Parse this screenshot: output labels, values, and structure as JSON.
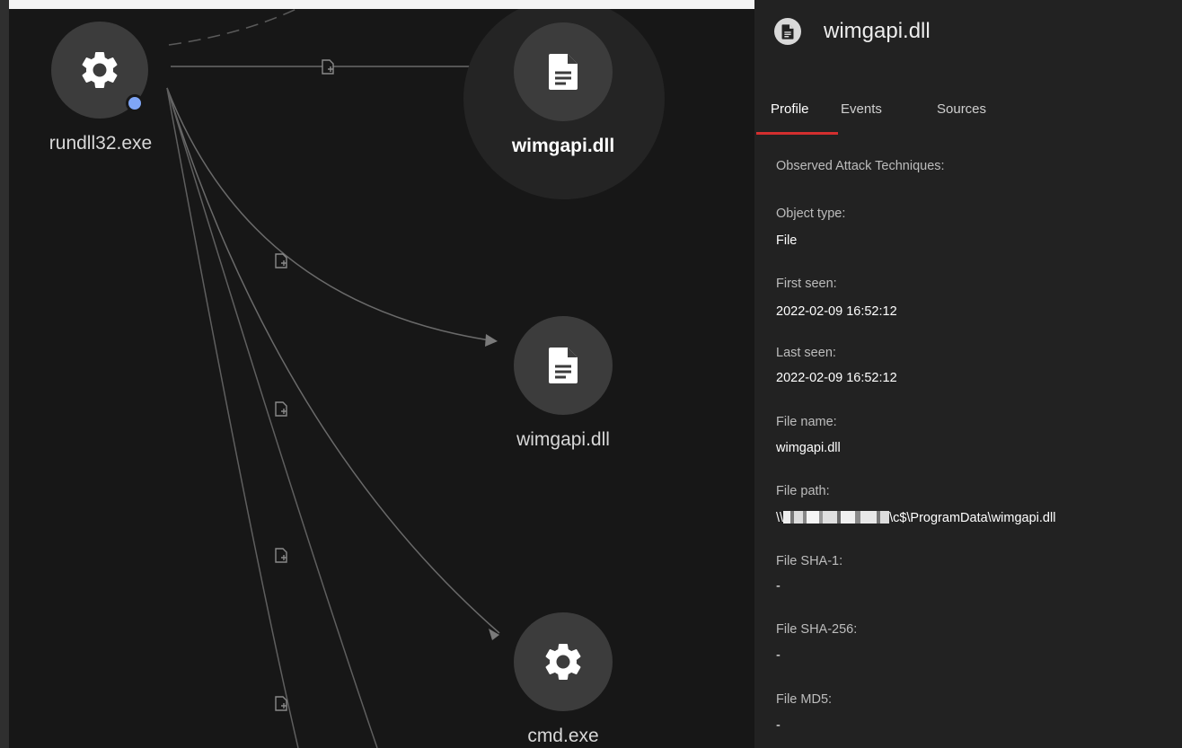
{
  "graph": {
    "nodes": {
      "rundll32": {
        "label": "rundll32.exe",
        "icon": "gear-icon"
      },
      "wimgapi_selected": {
        "label": "wimgapi.dll",
        "icon": "file-icon"
      },
      "wimgapi_second": {
        "label": "wimgapi.dll",
        "icon": "file-icon"
      },
      "cmd": {
        "label": "cmd.exe",
        "icon": "gear-icon"
      }
    },
    "edge_icon": "file-create-icon"
  },
  "panel": {
    "title": "wimgapi.dll",
    "header_icon": "file-icon",
    "tabs": [
      {
        "label": "Profile",
        "active": true
      },
      {
        "label": "Events",
        "active": false
      },
      {
        "label": "Sources",
        "active": false
      }
    ],
    "fields": {
      "attack_techniques": {
        "label": "Observed Attack Techniques:"
      },
      "object_type": {
        "label": "Object type:",
        "value": "File"
      },
      "first_seen": {
        "label": "First seen:",
        "value": "2022-02-09 16:52:12"
      },
      "last_seen": {
        "label": "Last seen:",
        "value": "2022-02-09 16:52:12"
      },
      "file_name": {
        "label": "File name:",
        "value": "wimgapi.dll"
      },
      "file_path": {
        "label": "File path:",
        "value_prefix": "\\\\",
        "value_suffix": "\\c$\\ProgramData\\wimgapi.dll"
      },
      "sha1": {
        "label": "File SHA-1:",
        "value": "-"
      },
      "sha256": {
        "label": "File SHA-256:",
        "value": "-"
      },
      "md5": {
        "label": "File MD5:",
        "value": "-"
      }
    }
  },
  "colors": {
    "background": "#161616",
    "panel": "#222222",
    "node": "#3c3c3c",
    "active_tab_underline": "#d32f2f",
    "badge": "#7fa6f7"
  }
}
